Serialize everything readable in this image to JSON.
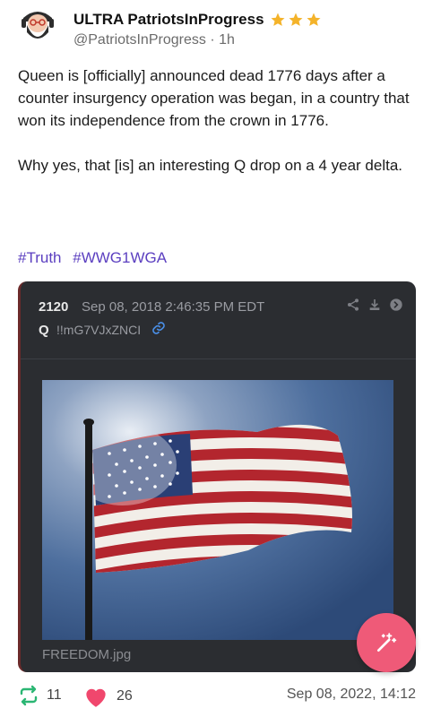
{
  "header": {
    "display_name": "ULTRA PatriotsInProgress",
    "handle": "@PatriotsInProgress",
    "separator": "·",
    "age": "1h",
    "star_count": 3,
    "star_color": "#f4b32a"
  },
  "post": {
    "text": "Queen is [officially] announced dead 1776 days after a counter insurgency operation was began, in a country that won its independence from the crown in 1776.\n\nWhy yes, that [is] an interesting Q drop on a 4 year delta.",
    "hashtags": [
      "#Truth",
      "#WWG1WGA"
    ]
  },
  "card": {
    "post_number": "2120",
    "date": "Sep 08, 2018 2:46:35 PM EDT",
    "author": "Q",
    "tripcode": "!!mG7VJxZNCI",
    "filename": "FREEDOM.jpg",
    "icons": [
      "share-icon",
      "download-icon",
      "arrow-right-icon"
    ]
  },
  "footer": {
    "repost_count": "11",
    "like_count": "26",
    "timestamp": "Sep 08, 2022, 14:12",
    "repost_color": "#2bb673",
    "like_color": "#f0476d"
  },
  "fab": {
    "icon": "magic-wand-icon",
    "color": "#ef5a78"
  }
}
